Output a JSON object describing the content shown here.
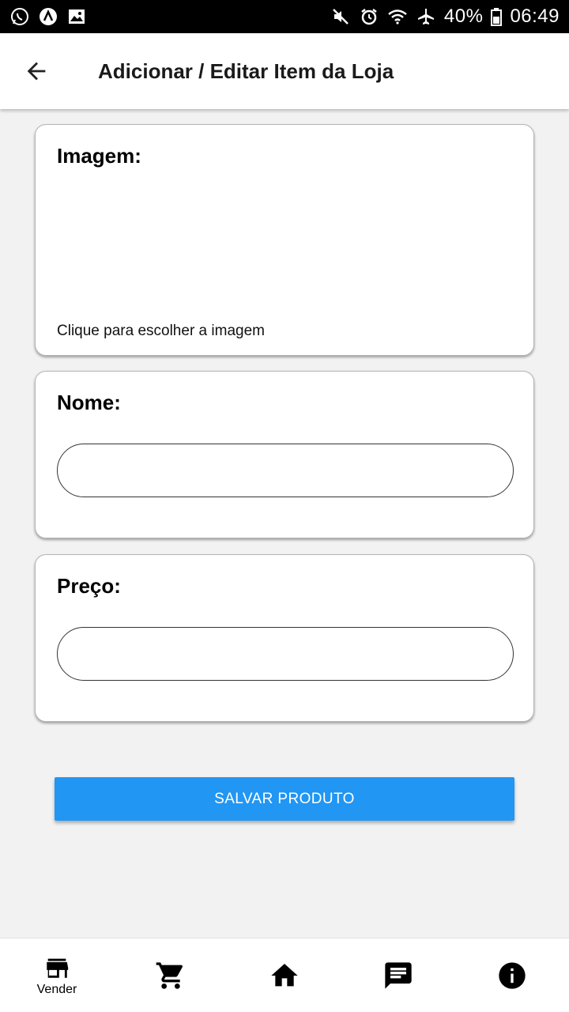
{
  "status_bar": {
    "left_icons": [
      "whatsapp-icon",
      "notification-a-icon",
      "gallery-icon"
    ],
    "right_icons": [
      "mute-icon",
      "alarm-icon",
      "wifi-icon",
      "airplane-icon",
      "battery-icon"
    ],
    "battery": "40%",
    "time": "06:49"
  },
  "app_bar": {
    "back_icon": "arrow-left-icon",
    "title": "Adicionar / Editar Item da Loja"
  },
  "image_card": {
    "label": "Imagem:",
    "hint": "Clique para escolher a imagem"
  },
  "name_card": {
    "label": "Nome:",
    "value": ""
  },
  "price_card": {
    "label": "Preço:",
    "value": ""
  },
  "save_button": {
    "label": "SALVAR PRODUTO",
    "color": "#2196f3"
  },
  "bottom_nav": {
    "items": [
      {
        "icon": "store-icon",
        "label": "Vender"
      },
      {
        "icon": "cart-icon",
        "label": ""
      },
      {
        "icon": "home-icon",
        "label": ""
      },
      {
        "icon": "chat-icon",
        "label": ""
      },
      {
        "icon": "info-icon",
        "label": ""
      }
    ]
  }
}
